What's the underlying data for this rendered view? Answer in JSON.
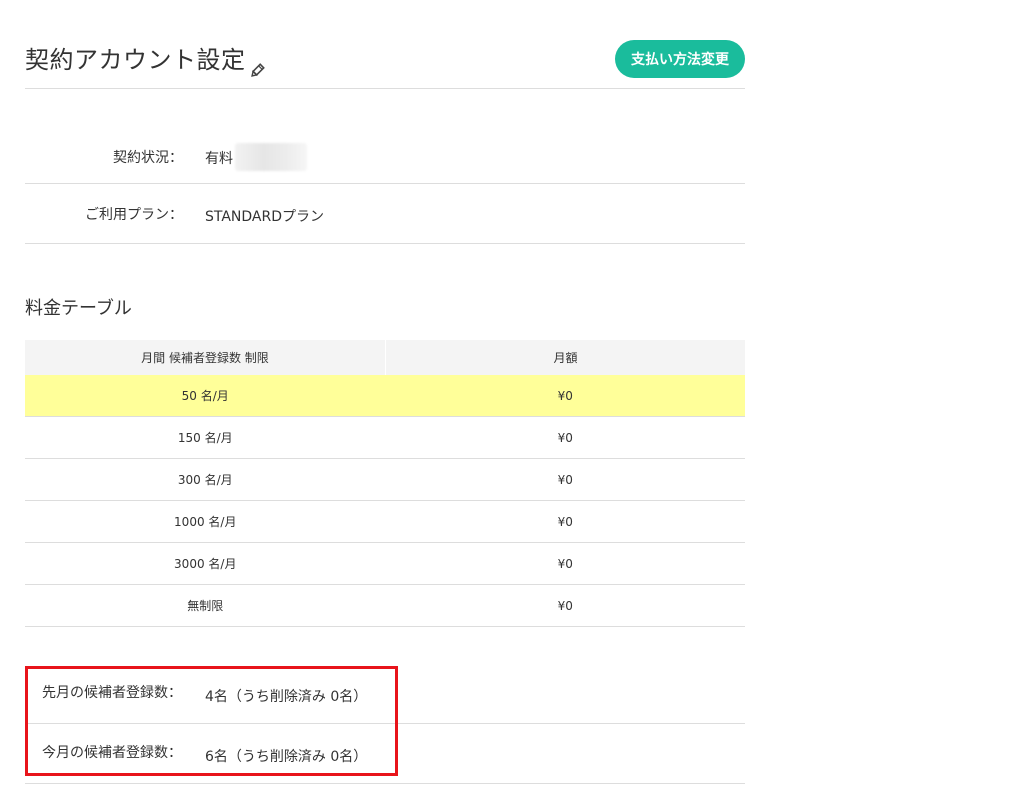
{
  "header": {
    "title": "契約アカウント設定",
    "edit_icon": "pencil-icon",
    "pay_button_label": "支払い方法変更"
  },
  "account": {
    "status_label": "契約状況：",
    "status_value": "有料",
    "plan_label": "ご利用プラン：",
    "plan_value": "STANDARDプラン"
  },
  "pricing": {
    "section_title": "料金テーブル",
    "columns": [
      "月間 候補者登録数 制限",
      "月額"
    ],
    "rows": [
      {
        "limit": "50 名/月",
        "price": "¥0",
        "current": true
      },
      {
        "limit": "150 名/月",
        "price": "¥0",
        "current": false
      },
      {
        "limit": "300 名/月",
        "price": "¥0",
        "current": false
      },
      {
        "limit": "1000 名/月",
        "price": "¥0",
        "current": false
      },
      {
        "limit": "3000 名/月",
        "price": "¥0",
        "current": false
      },
      {
        "limit": "無制限",
        "price": "¥0",
        "current": false
      }
    ]
  },
  "stats": {
    "last_month_label": "先月の候補者登録数：",
    "last_month_value": "4名（うち削除済み 0名）",
    "this_month_label": "今月の候補者登録数：",
    "this_month_value": "6名（うち削除済み 0名）"
  },
  "colors": {
    "accent": "#1abc9c",
    "highlight_row": "#ffff99",
    "annotation_frame": "#e8141b"
  }
}
